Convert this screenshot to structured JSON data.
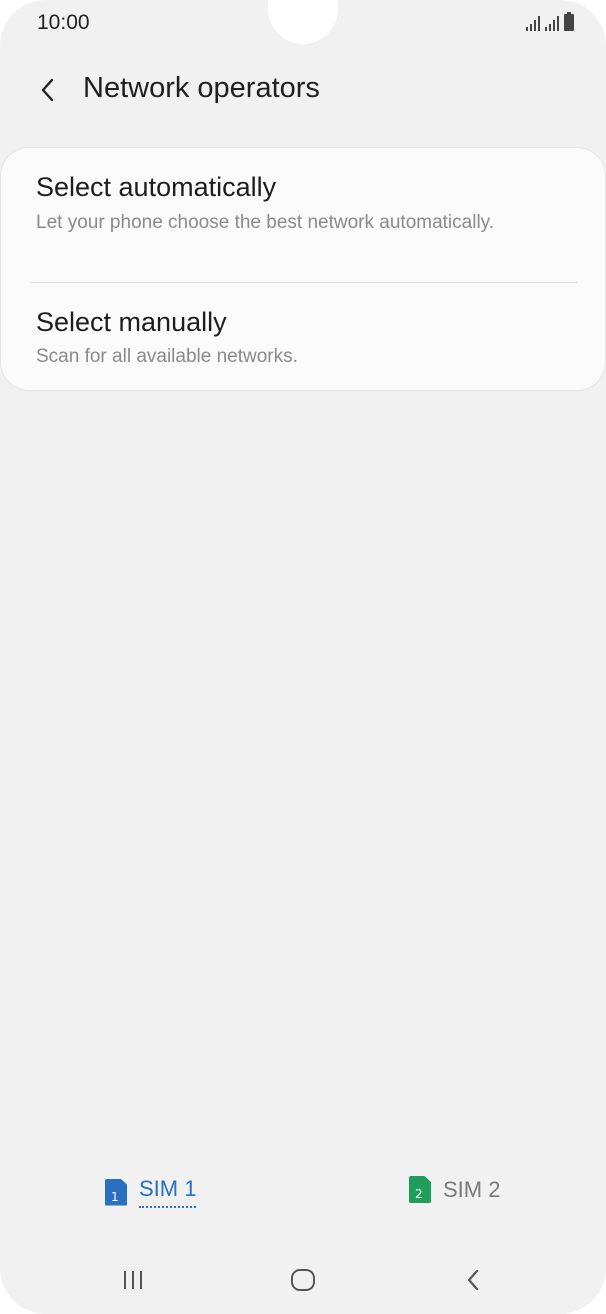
{
  "status_bar": {
    "time": "10:00"
  },
  "header": {
    "title": "Network operators",
    "back_icon": "chevron-left-icon"
  },
  "options": [
    {
      "title": "Select automatically",
      "subtitle": "Let your phone choose the best network automatically."
    },
    {
      "title": "Select manually",
      "subtitle": "Scan for all available networks."
    }
  ],
  "sim_tabs": [
    {
      "label": "SIM 1",
      "badge": "1",
      "color": "#2a6fc0",
      "selected": true
    },
    {
      "label": "SIM 2",
      "badge": "2",
      "color": "#1e9e5a",
      "selected": false
    }
  ],
  "nav_bar": {
    "recents_icon": "recents-icon",
    "home_icon": "home-icon",
    "back_icon": "back-icon"
  }
}
